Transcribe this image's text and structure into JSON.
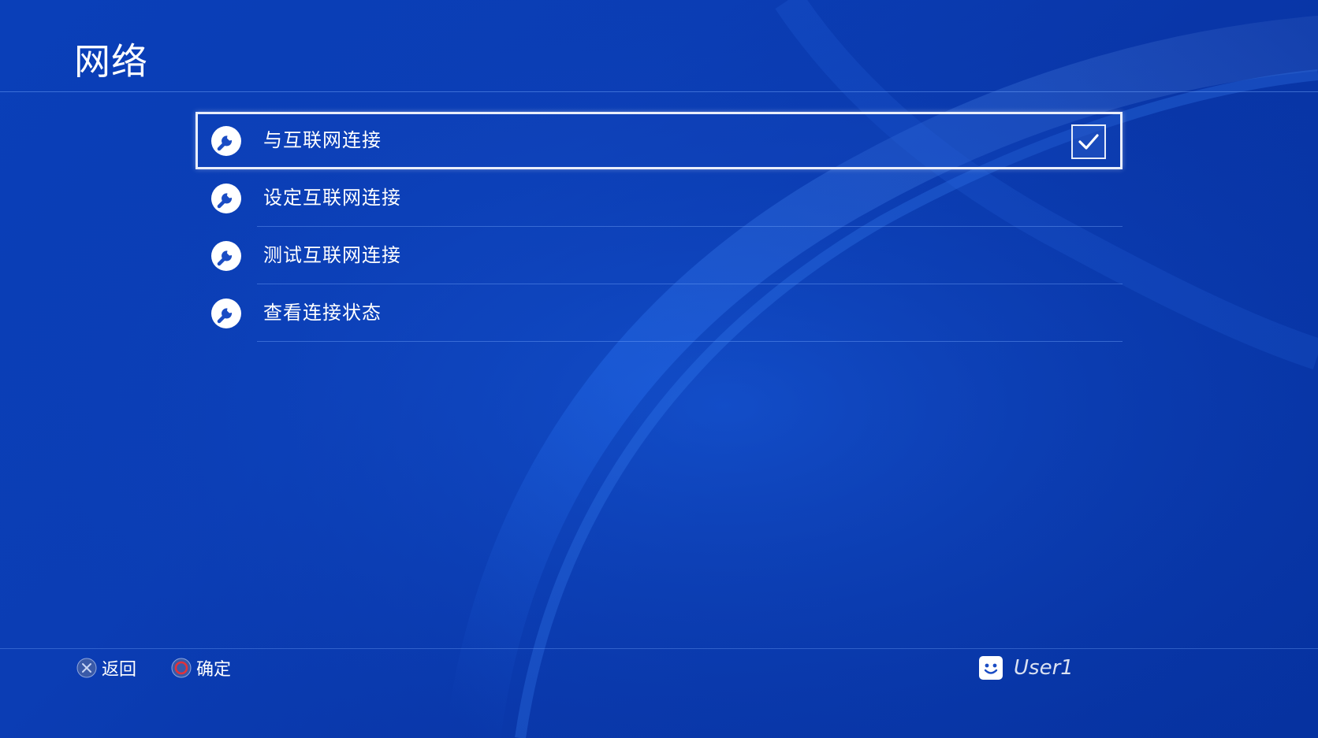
{
  "page": {
    "title": "网络"
  },
  "menu": {
    "items": [
      {
        "label": "与互联网连接",
        "icon": "wrench-icon",
        "selected": true,
        "checked": true
      },
      {
        "label": "设定互联网连接",
        "icon": "wrench-icon",
        "selected": false,
        "checked": false
      },
      {
        "label": "测试互联网连接",
        "icon": "wrench-icon",
        "selected": false,
        "checked": false
      },
      {
        "label": "查看连接状态",
        "icon": "wrench-icon",
        "selected": false,
        "checked": false
      }
    ]
  },
  "footer": {
    "back_label": "返回",
    "back_icon": "cross-button-icon",
    "confirm_label": "确定",
    "confirm_icon": "circle-button-icon",
    "user_name": "User1",
    "user_icon": "avatar-face-icon"
  },
  "colors": {
    "background": "#0a3bb0",
    "text": "#ffffff",
    "selection_border": "#e9eefb",
    "circle_button": "#e2323a"
  }
}
